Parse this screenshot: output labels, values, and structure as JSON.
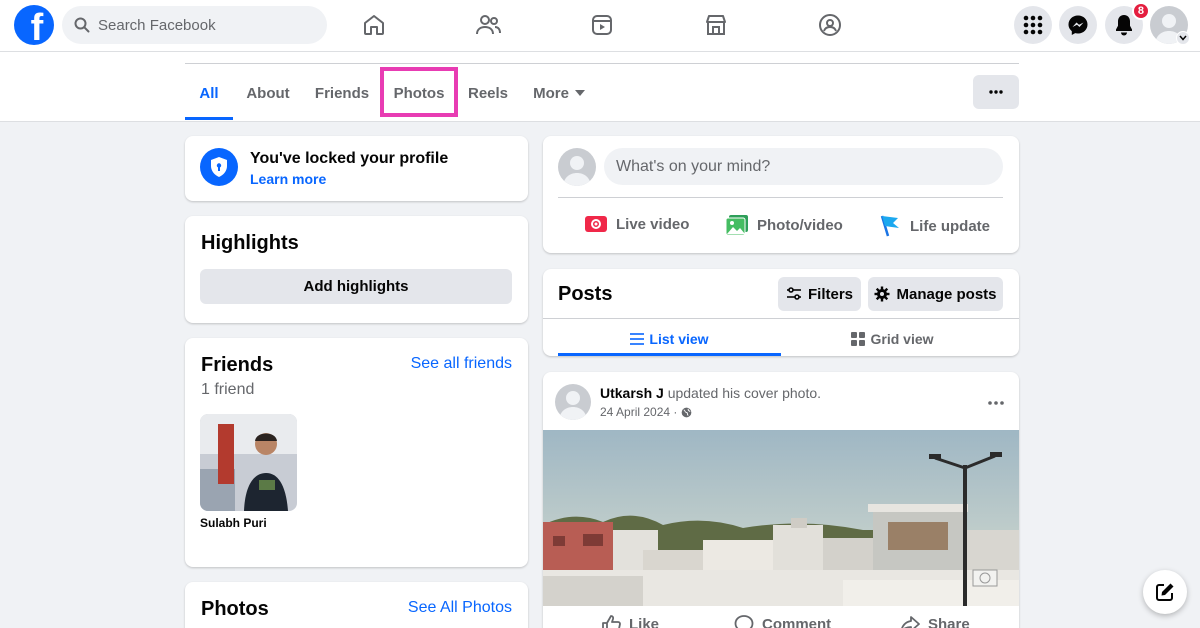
{
  "topbar": {
    "logo": "facebook-logo",
    "search_placeholder": "Search Facebook",
    "notification_count": "8"
  },
  "tabs": [
    {
      "label": "All"
    },
    {
      "label": "About"
    },
    {
      "label": "Friends"
    },
    {
      "label": "Photos"
    },
    {
      "label": "Reels"
    },
    {
      "label": "More"
    }
  ],
  "locked": {
    "title": "You've locked your profile",
    "link": "Learn more"
  },
  "highlights": {
    "title": "Highlights",
    "button": "Add highlights"
  },
  "friends": {
    "title": "Friends",
    "see_all": "See all friends",
    "count": "1 friend",
    "items": [
      {
        "name": "Sulabh Puri"
      }
    ]
  },
  "photos": {
    "title": "Photos",
    "see_all": "See All Photos"
  },
  "composer": {
    "placeholder": "What's on your mind?",
    "live": "Live video",
    "photo": "Photo/video",
    "life": "Life update"
  },
  "posts": {
    "title": "Posts",
    "filters": "Filters",
    "manage": "Manage posts",
    "list_view": "List view",
    "grid_view": "Grid view"
  },
  "post": {
    "author": "Utkarsh J",
    "action": "updated his cover photo.",
    "date": "24 April 2024 ·",
    "like": "Like",
    "comment": "Comment",
    "share": "Share"
  },
  "colors": {
    "brand": "#0866ff",
    "highlight": "#e83cb3",
    "badge": "#e41e3f"
  }
}
